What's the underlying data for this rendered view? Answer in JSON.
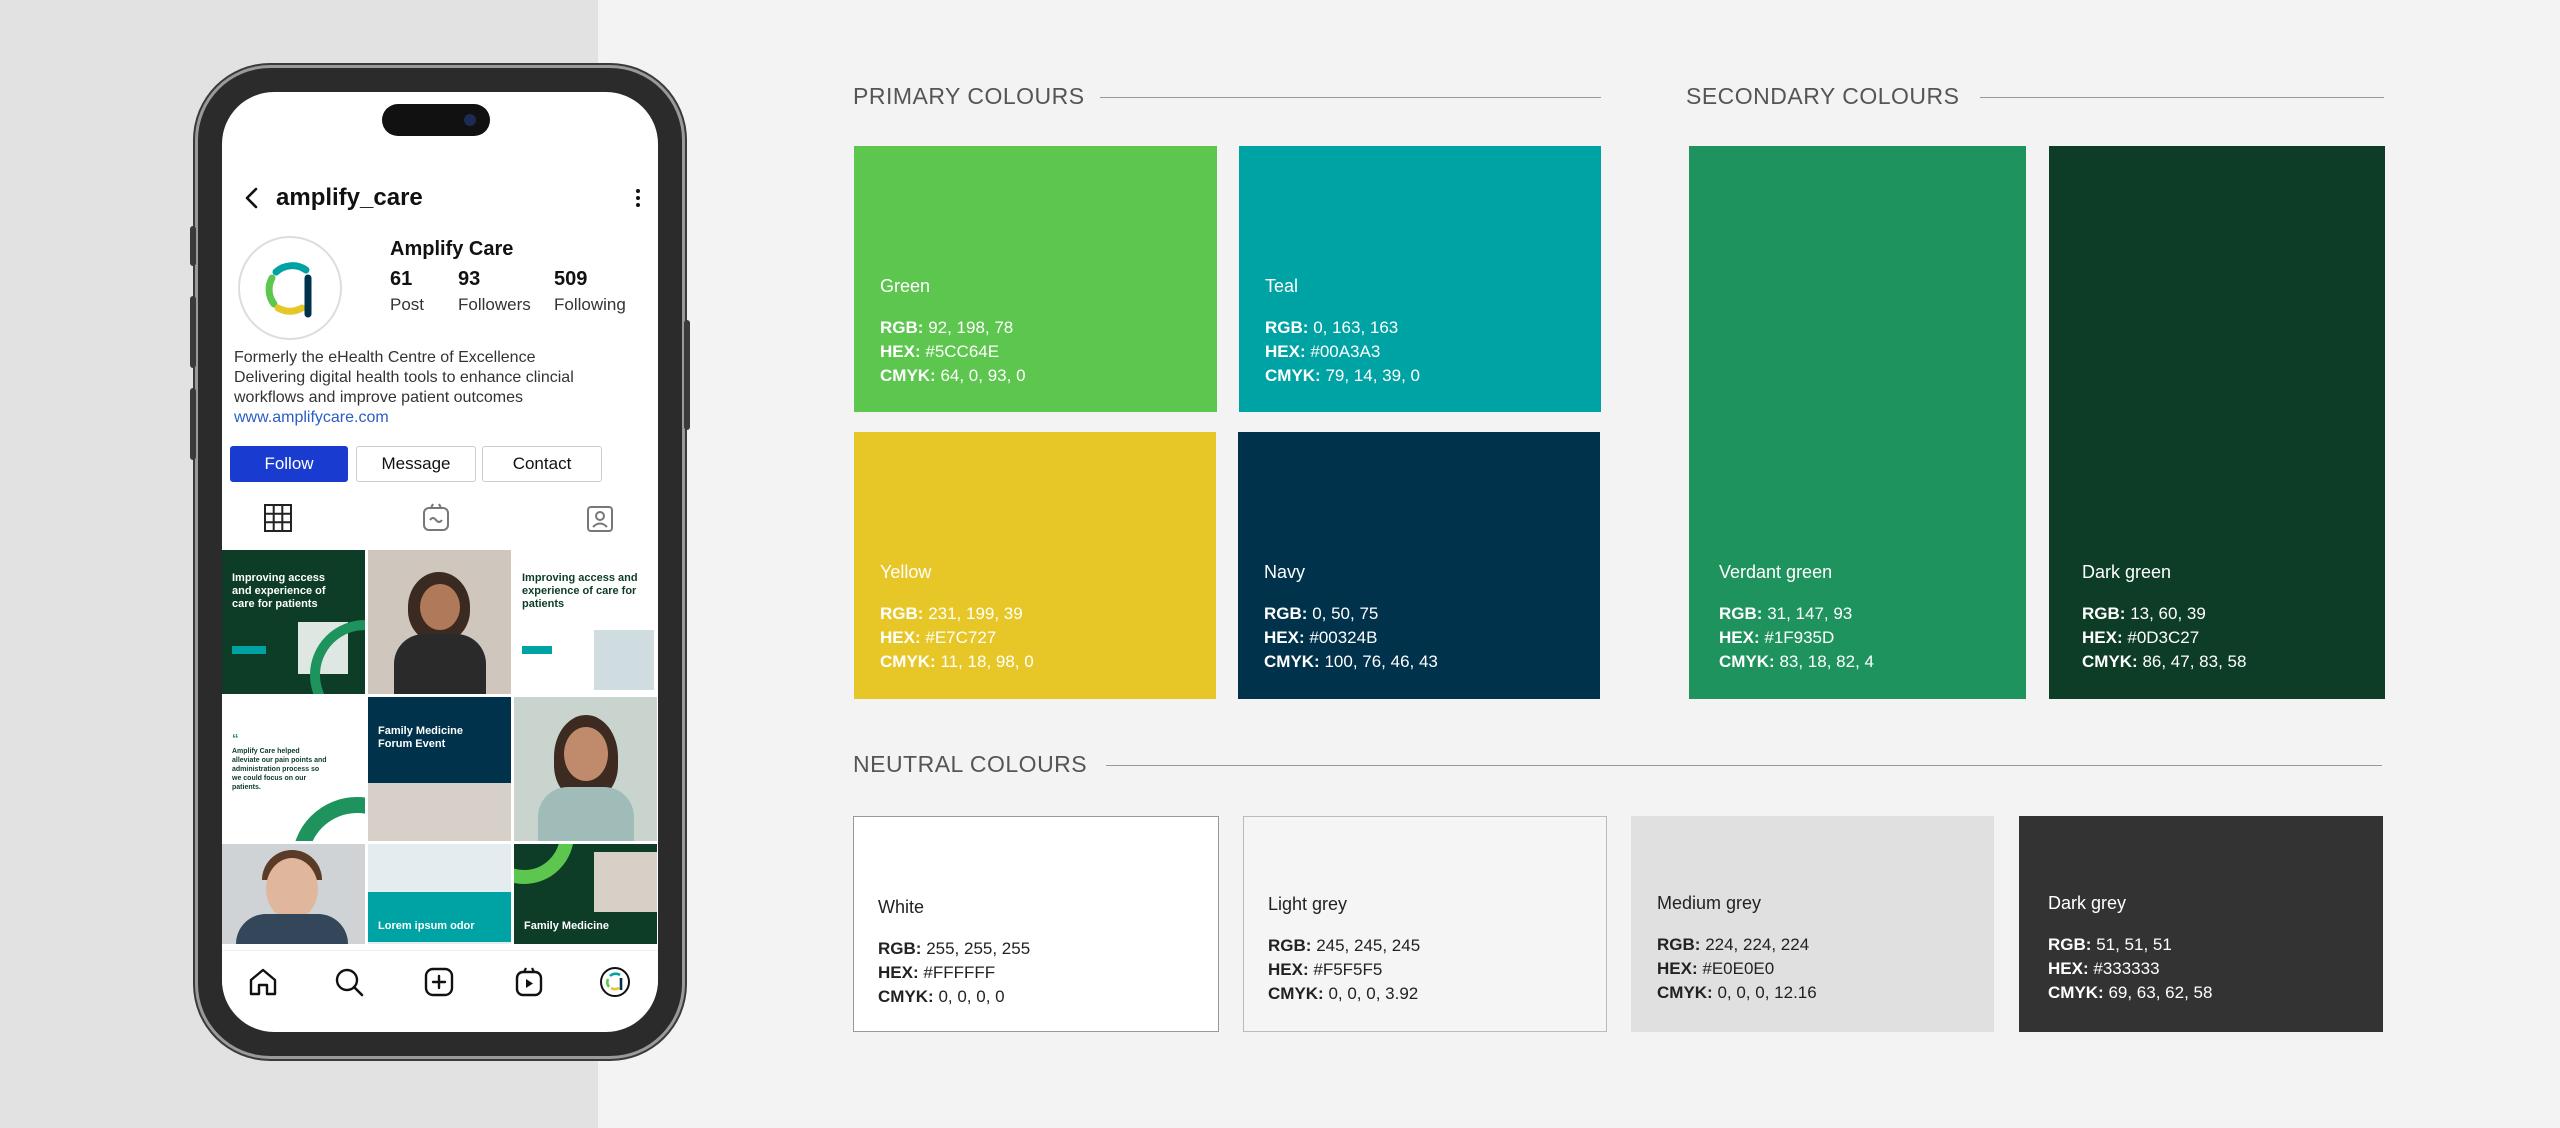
{
  "phone": {
    "username": "amplify_care",
    "profile_name": "Amplify Care",
    "stats": [
      {
        "num": "61",
        "label": "Post"
      },
      {
        "num": "93",
        "label": "Followers"
      },
      {
        "num": "509",
        "label": "Following"
      }
    ],
    "bio": [
      "Formerly the eHealth Centre of Excellence",
      "Delivering digital health tools to enhance clincial",
      "workflows and improve patient outcomes"
    ],
    "link": "www.amplifycare.com",
    "buttons": {
      "follow": "Follow",
      "message": "Message",
      "contact": "Contact"
    },
    "posts": {
      "p1_headline": "Improving access and experience of care for patients",
      "p3_headline": "Improving access and experience of care for patients",
      "p4_quote": "Amplify Care helped alleviate our pain points and administration process so we could focus on our patients.",
      "p5_headline": "Family Medicine Forum Event",
      "p8_headline": "Lorem ipsum odor",
      "p9_headline": "Family Medicine"
    },
    "icons": [
      "back-icon",
      "more-icon",
      "grid-icon",
      "reels-icon",
      "tagged-icon",
      "home-icon",
      "search-icon",
      "add-icon",
      "reels-nav-icon",
      "profile-icon"
    ]
  },
  "sections": {
    "primary": "PRIMARY COLOURS",
    "secondary": "SECONDARY COLOURS",
    "neutral": "NEUTRAL COLOURS"
  },
  "colours": {
    "green": {
      "name": "Green",
      "rgb": "92, 198, 78",
      "hex": "#5CC64E",
      "cmyk": "64, 0, 93, 0"
    },
    "teal": {
      "name": "Teal",
      "rgb": "0, 163, 163",
      "hex": "#00A3A3",
      "cmyk": "79, 14, 39, 0"
    },
    "yellow": {
      "name": "Yellow",
      "rgb": "231, 199, 39",
      "hex": "#E7C727",
      "cmyk": "11, 18, 98, 0"
    },
    "navy": {
      "name": "Navy",
      "rgb": "0, 50, 75",
      "hex": "#00324B",
      "cmyk": "100, 76, 46, 43"
    },
    "verdant": {
      "name": "Verdant green",
      "rgb": "31, 147, 93",
      "hex": "#1F935D",
      "cmyk": "83, 18, 82, 4"
    },
    "darkgreen": {
      "name": "Dark green",
      "rgb": "13, 60, 39",
      "hex": "#0D3C27",
      "cmyk": "86, 47, 83, 58"
    },
    "white": {
      "name": "White",
      "rgb": "255, 255, 255",
      "hex": "#FFFFFF",
      "cmyk": "0, 0, 0, 0"
    },
    "lightgrey": {
      "name": "Light grey",
      "rgb": "245, 245, 245",
      "hex": "#F5F5F5",
      "cmyk": "0, 0, 0, 3.92"
    },
    "mediumgrey": {
      "name": "Medium grey",
      "rgb": "224, 224, 224",
      "hex": "#E0E0E0",
      "cmyk": "0, 0, 0, 12.16"
    },
    "darkgrey": {
      "name": "Dark grey",
      "rgb": "51, 51, 51",
      "hex": "#333333",
      "cmyk": "69, 63, 62, 58"
    }
  },
  "labels": {
    "rgb": "RGB:",
    "hex": "HEX:",
    "cmyk": "CMYK:"
  }
}
